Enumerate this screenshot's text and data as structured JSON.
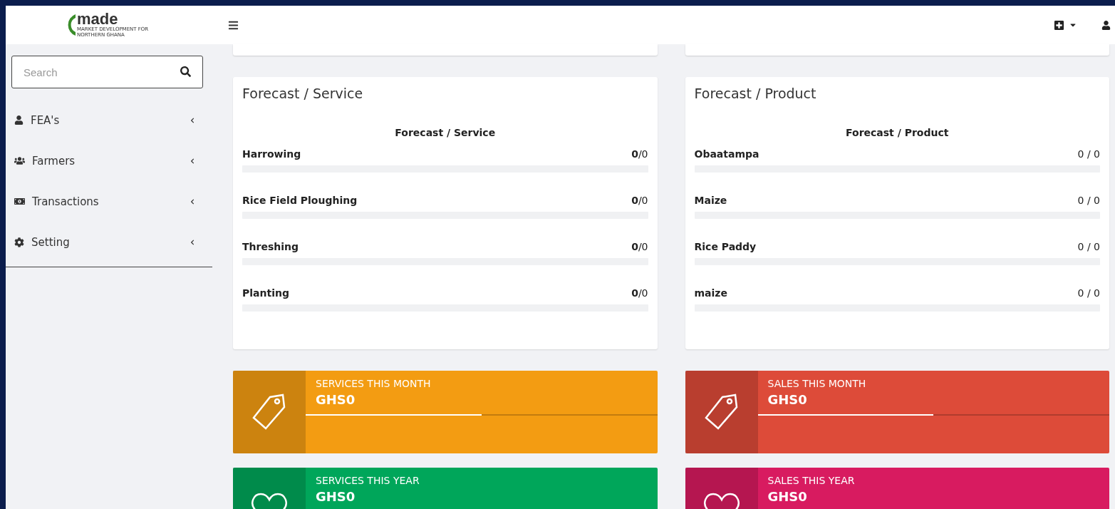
{
  "logo": {
    "name": "made",
    "tagline": "MARKET DEVELOPMENT FOR NORTHERN GHANA"
  },
  "search": {
    "placeholder": "Search"
  },
  "sidebar": {
    "items": [
      {
        "label": "FEA's",
        "kind": "user",
        "expanded": false
      },
      {
        "label": "Farmers",
        "kind": "users",
        "expanded": false
      },
      {
        "label": "Transactions",
        "kind": "money",
        "expanded": false
      },
      {
        "label": "Setting",
        "kind": "gear",
        "expanded": false
      }
    ]
  },
  "panels": [
    {
      "title": "Forecast / Service",
      "subtitle": "Forecast / Service",
      "rows": [
        {
          "name": "Harrowing",
          "count": "**0**/0",
          "level": 0
        },
        {
          "name": "Rice Field Ploughing",
          "count": "**0**/0",
          "level": 0
        },
        {
          "name": "Threshing",
          "count": "**0**/0",
          "level": 0
        },
        {
          "name": "Planting",
          "count": "**0**/0",
          "level": 0
        }
      ]
    },
    {
      "title": "Forecast / Product",
      "subtitle": "Forecast / Product",
      "rows": [
        {
          "name": "Obaatampa",
          "count": "0 / 0",
          "level": 0
        },
        {
          "name": "Maize",
          "count": "0 / 0",
          "level": 0
        },
        {
          "name": "Rice Paddy",
          "count": "0 / 0",
          "level": 0
        },
        {
          "name": "maize",
          "count": "0 / 0",
          "level": 0
        }
      ]
    }
  ],
  "info_boxes": [
    {
      "label": "SERVICES THIS MONTH",
      "value": "GHS0",
      "kind": "tag",
      "color": "#f39c12",
      "level": 0.5
    },
    {
      "label": "SALES THIS MONTH",
      "value": "GHS0",
      "kind": "tag",
      "color": "#dd4b39",
      "level": 0.5
    },
    {
      "label": "SERVICES THIS YEAR",
      "value": "GHS0",
      "kind": "heart",
      "color": "#00a65a"
    },
    {
      "label": "SALES THIS YEAR",
      "value": "GHS0",
      "kind": "heart",
      "color": "#d81b60"
    }
  ]
}
